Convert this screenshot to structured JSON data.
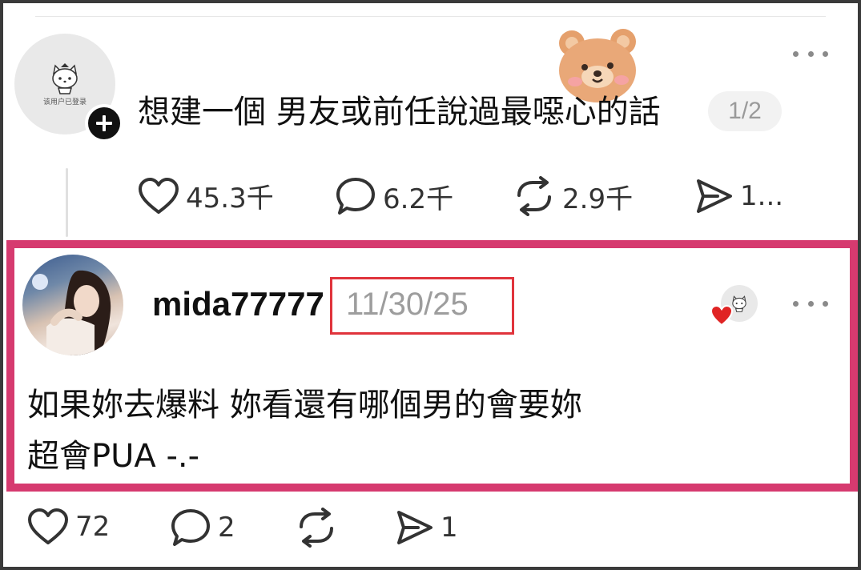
{
  "post": {
    "avatar_caption": "该用户已登录",
    "title": "想建一個 男友或前任說過最噁心的話",
    "page_indicator": "1/2",
    "actions": {
      "likes": "45.3千",
      "comments": "6.2千",
      "reposts": "2.9千",
      "shares": "1..."
    }
  },
  "reply": {
    "username": "mida77777",
    "date": "11/30/25",
    "lines": [
      "如果妳去爆料 妳看還有哪個男的會要妳",
      "超會PUA -.-"
    ],
    "actions": {
      "likes": "72",
      "comments": "2",
      "shares": "1"
    }
  },
  "colors": {
    "highlight_border": "#d63a6f",
    "date_box": "#e0343c",
    "heart_badge": "#e02424"
  },
  "icons": {
    "like": "heart-outline-icon",
    "comment": "speech-bubble-icon",
    "repost": "repost-arrows-icon",
    "share": "paper-plane-icon",
    "follow": "plus-icon",
    "more": "ellipsis-icon"
  }
}
